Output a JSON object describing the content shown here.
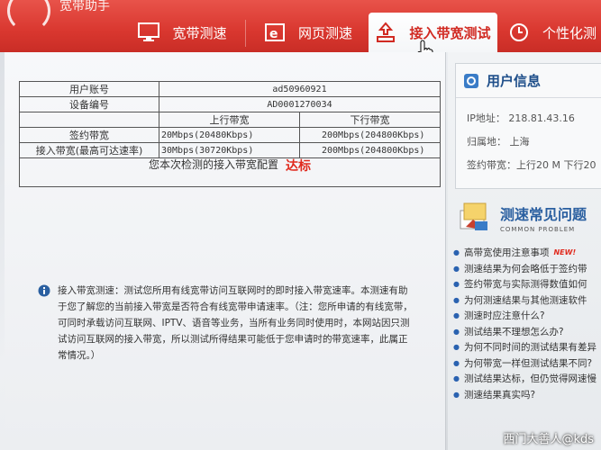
{
  "app": {
    "title": "宽带助手"
  },
  "tabs": [
    {
      "label": "宽带测速",
      "icon": "monitor-icon"
    },
    {
      "label": "网页测速",
      "icon": "browser-icon"
    },
    {
      "label": "接入带宽测试",
      "icon": "upload-icon",
      "active": true
    },
    {
      "label": "个性化测",
      "icon": "clock-icon"
    }
  ],
  "table": {
    "account_label": "用户账号",
    "account_value": "ad50960921",
    "device_label": "设备编号",
    "device_value": "AD0001270034",
    "upload_header": "上行带宽",
    "download_header": "下行带宽",
    "contract_label": "签约带宽",
    "contract_up": "20Mbps(20480Kbps)",
    "contract_down": "200Mbps(204800Kbps)",
    "access_label": "接入带宽(最高可达速率)",
    "access_up": "30Mbps(30720Kbps)",
    "access_down": "200Mbps(204800Kbps)"
  },
  "result": {
    "text": "您本次检测的接入带宽配置",
    "status": "达标"
  },
  "description": "接入带宽测速：测试您所用有线宽带访问互联网时的即时接入带宽速率。本测速有助于您了解您的当前接入带宽是否符合有线宽带申请速率。（注：您所申请的有线宽带，可同时承载访问互联网、IPTV、语音等业务，当所有业务同时使用时，本网站因只测试访问互联网的接入带宽，所以测试所得结果可能低于您申请时的带宽速率，此属正常情况。）",
  "user_info": {
    "title": "用户信息",
    "ip": "IP地址：  218.81.43.16",
    "location": "归属地：  上海",
    "contract": "签约带宽：上行20 M  下行20"
  },
  "faq": {
    "title": "测速常见问题",
    "subtitle": "COMMON PROBLEM",
    "new_badge": "NEW!",
    "items": [
      "高带宽使用注意事项",
      "测速结果为何会略低于签约带",
      "签约带宽与实际测得数值如何",
      "为何测速结果与其他测速软件",
      "测速时应注意什么?",
      "测试结果不理想怎么办?",
      "为何不同时间的测试结果有差异",
      "为何带宽一样但测试结果不同?",
      "测试结果达标，但仍觉得网速慢",
      "测速结果真实吗?"
    ]
  },
  "watermark": "西门大善人@kds",
  "colors": {
    "brand_red": "#d9372f",
    "status_red": "#e02a1e",
    "link_blue": "#2a5fa0"
  }
}
